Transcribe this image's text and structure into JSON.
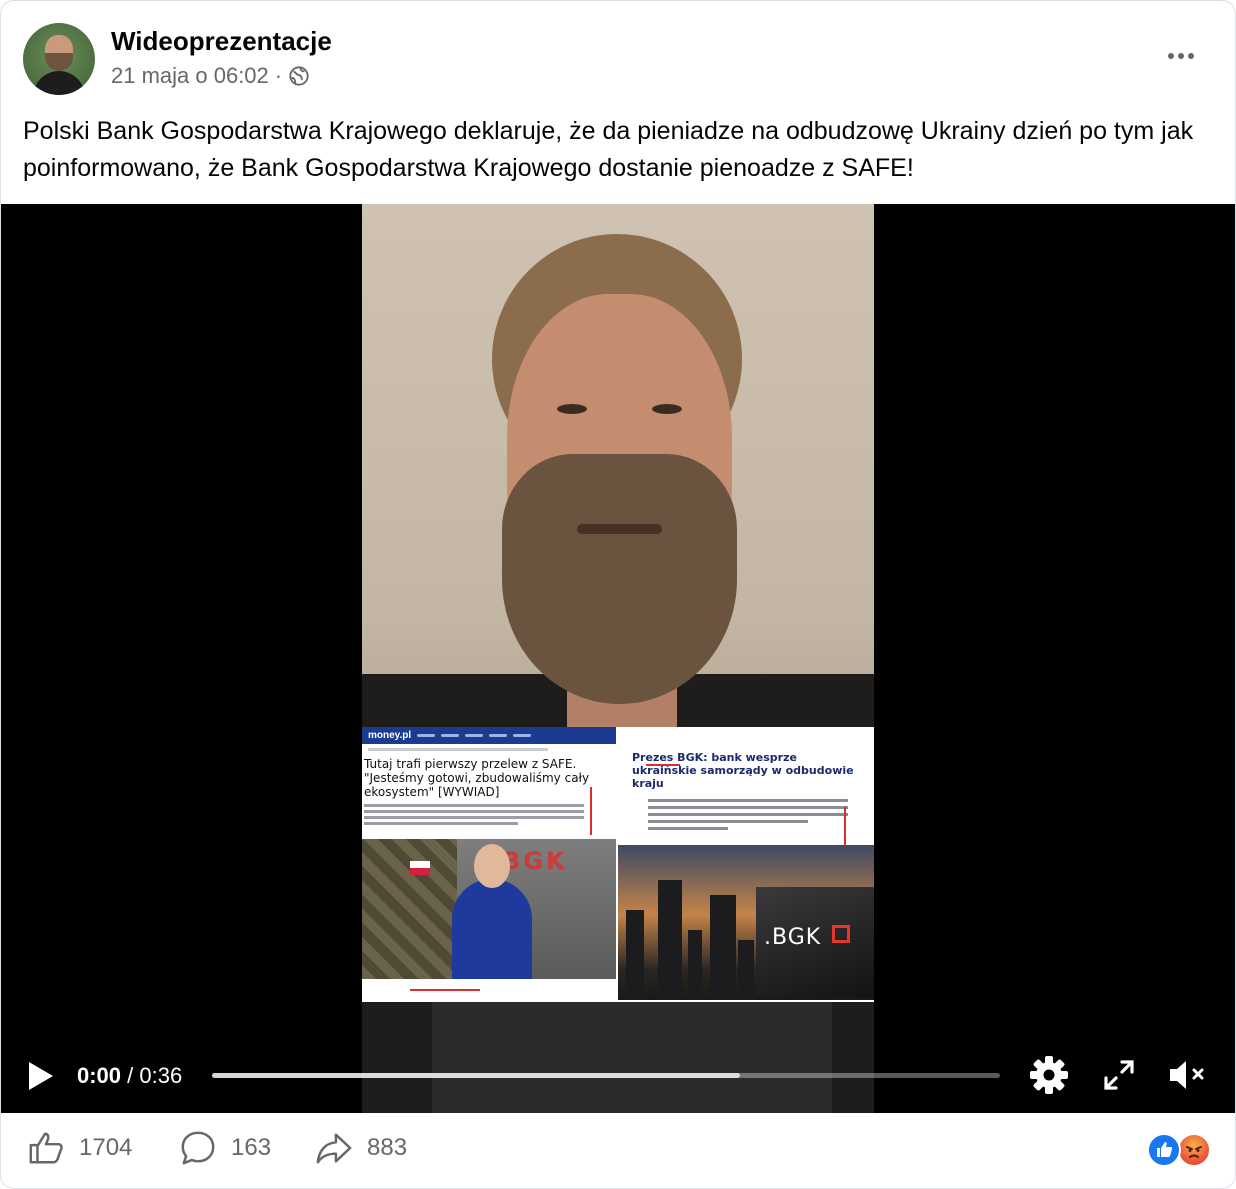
{
  "post": {
    "author": "Wideoprezentacje",
    "timestamp": "21 maja o 06:02",
    "separator": "·",
    "privacy_icon": "globe-icon",
    "text": "Polski Bank Gospodarstwa Krajowego deklaruje, że da pieniadze na odbudzowę Ukrainy dzień po tym jak poinformowano, że Bank Gospodarstwa Krajowego dostanie pienoadze z SAFE!"
  },
  "video": {
    "current_time": "0:00",
    "time_separator": " / ",
    "duration": "0:36",
    "buffered_fraction": 0.67,
    "screens": {
      "left_site": "money.pl",
      "left_headline": "Tutaj trafi pierwszy przelew z SAFE. \"Jesteśmy gotowi, zbudowaliśmy cały ekosystem\" [WYWIAD]",
      "left_photo_sign": "BGK",
      "right_headline": "Prezes BGK: bank wesprze ukraińskie samorządy w odbudowie kraju",
      "right_photo_logo": ".BGK"
    }
  },
  "actions": {
    "likes": "1704",
    "comments": "163",
    "shares": "883"
  },
  "colors": {
    "text": "#050505",
    "muted": "#65676b",
    "like_blue": "#1877f2",
    "angry_orange": "#f05a3e"
  }
}
